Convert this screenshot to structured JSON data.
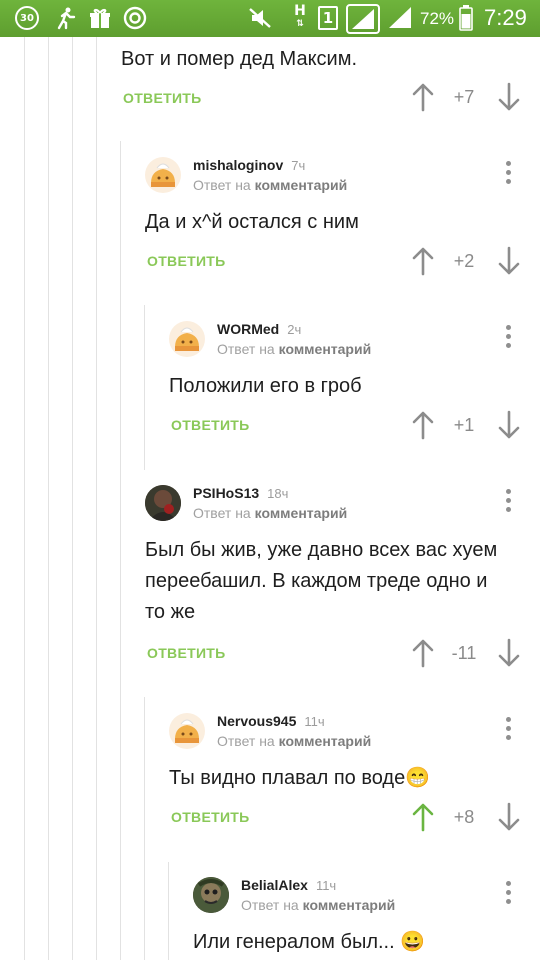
{
  "status_bar": {
    "notification_badge": "30",
    "network": "H",
    "sim": "1",
    "battery": "72%",
    "time": "7:29"
  },
  "colors": {
    "accent": "#8ac858",
    "upvoted": "#6ab541",
    "statusbar": "#66a834"
  },
  "comments": [
    {
      "author": "",
      "time": "",
      "reply_prefix": "",
      "reply_link": "",
      "text": "Вот и помер дед Максим.",
      "reply_label": "ОТВЕТИТЬ",
      "score": "+7",
      "upvoted": false
    },
    {
      "author": "mishaloginov",
      "time": "7ч",
      "reply_prefix": "Ответ на",
      "reply_link": "комментарий",
      "text": "Да и х^й остался с ним",
      "reply_label": "ОТВЕТИТЬ",
      "score": "+2",
      "upvoted": false
    },
    {
      "author": "WORMed",
      "time": "2ч",
      "reply_prefix": "Ответ на",
      "reply_link": "комментарий",
      "text": "Положили его в гроб",
      "reply_label": "ОТВЕТИТЬ",
      "score": "+1",
      "upvoted": false
    },
    {
      "author": "PSIHoS13",
      "time": "18ч",
      "reply_prefix": "Ответ на",
      "reply_link": "комментарий",
      "text_lines": [
        "Был бы жив, уже давно всех вас хуем",
        "переебашил. В каждом треде одно и",
        "то же"
      ],
      "reply_label": "ОТВЕТИТЬ",
      "score": "-11",
      "upvoted": false
    },
    {
      "author": "Nervous945",
      "time": "11ч",
      "reply_prefix": "Ответ на",
      "reply_link": "комментарий",
      "text": "Ты видно плавал по воде😁",
      "reply_label": "ОТВЕТИТЬ",
      "score": "+8",
      "upvoted": true
    },
    {
      "author": "BelialAlex",
      "time": "11ч",
      "reply_prefix": "Ответ на",
      "reply_link": "комментарий",
      "text": "Или генералом был... 😀"
    }
  ]
}
